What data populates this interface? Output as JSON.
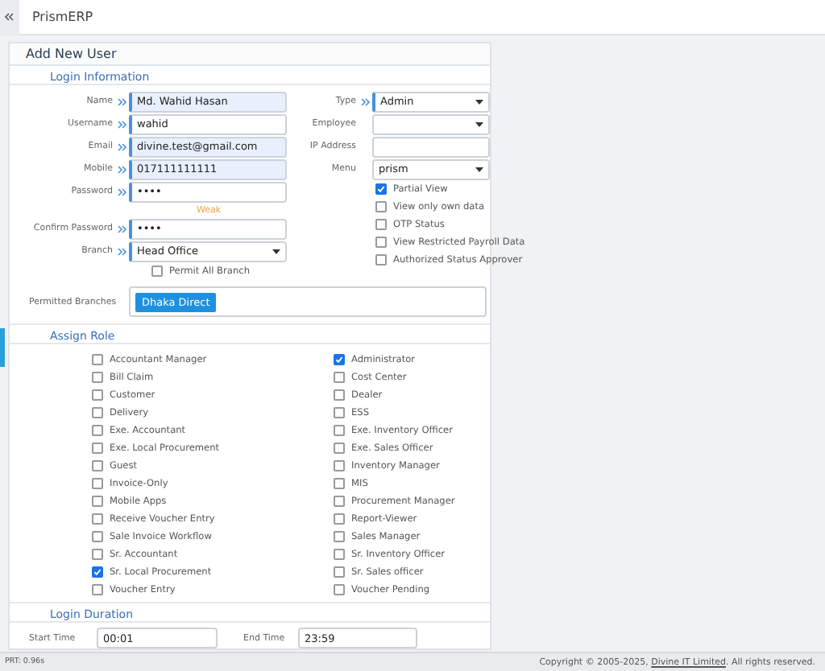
{
  "header": {
    "app_title": "PrismERP"
  },
  "form": {
    "title": "Add New User",
    "login_information": {
      "heading": "Login Information",
      "left_fields": [
        {
          "label": "Name",
          "kind": "text",
          "required": true,
          "autofilled": true,
          "value": "Md. Wahid Hasan"
        },
        {
          "label": "Username",
          "kind": "text",
          "required": true,
          "autofilled": false,
          "value": "wahid"
        },
        {
          "label": "Email",
          "kind": "text",
          "required": true,
          "autofilled": true,
          "value": "divine.test@gmail.com"
        },
        {
          "label": "Mobile",
          "kind": "text",
          "required": true,
          "autofilled": true,
          "value": "017111111111"
        },
        {
          "label": "Password",
          "kind": "password",
          "required": true,
          "autofilled": false,
          "value": "••••",
          "strength": "Weak"
        },
        {
          "label": "Confirm Password",
          "kind": "password",
          "required": true,
          "autofilled": false,
          "value": "••••"
        },
        {
          "label": "Branch",
          "kind": "select",
          "required": true,
          "autofilled": false,
          "value": "Head Office"
        }
      ],
      "permit_all_branch": {
        "label": "Permit All Branch",
        "checked": false
      },
      "right_fields": [
        {
          "label": "Type",
          "kind": "select",
          "required": true,
          "value": "Admin"
        },
        {
          "label": "Employee",
          "kind": "select",
          "required": false
        },
        {
          "label": "IP Address",
          "kind": "text",
          "required": false
        },
        {
          "label": "Menu",
          "kind": "select",
          "required": false,
          "value": "prism"
        }
      ],
      "options": [
        {
          "label": "Partial View",
          "checked": true
        },
        {
          "label": "View only own data",
          "checked": false
        },
        {
          "label": "OTP Status",
          "checked": false
        },
        {
          "label": "View Restricted Payroll Data",
          "checked": false
        },
        {
          "label": "Authorized Status Approver",
          "checked": false
        }
      ],
      "permitted_branches": {
        "label": "Permitted Branches",
        "tags": [
          "Dhaka Direct"
        ]
      }
    },
    "assign_role": {
      "heading": "Assign Role",
      "roles": [
        {
          "label": "Accountant Manager",
          "checked": false
        },
        {
          "label": "Administrator",
          "checked": true
        },
        {
          "label": "Bill Claim",
          "checked": false
        },
        {
          "label": "Cost Center",
          "checked": false
        },
        {
          "label": "Customer",
          "checked": false
        },
        {
          "label": "Dealer",
          "checked": false
        },
        {
          "label": "Delivery",
          "checked": false
        },
        {
          "label": "ESS",
          "checked": false
        },
        {
          "label": "Exe. Accountant",
          "checked": false
        },
        {
          "label": "Exe. Inventory Officer",
          "checked": false
        },
        {
          "label": "Exe. Local Procurement",
          "checked": false
        },
        {
          "label": "Exe. Sales Officer",
          "checked": false
        },
        {
          "label": "Guest",
          "checked": false
        },
        {
          "label": "Inventory Manager",
          "checked": false
        },
        {
          "label": "Invoice-Only",
          "checked": false
        },
        {
          "label": "MIS",
          "checked": false
        },
        {
          "label": "Mobile Apps",
          "checked": false
        },
        {
          "label": "Procurement Manager",
          "checked": false
        },
        {
          "label": "Receive Voucher Entry",
          "checked": false
        },
        {
          "label": "Report-Viewer",
          "checked": false
        },
        {
          "label": "Sale Invoice Workflow",
          "checked": false
        },
        {
          "label": "Sales Manager",
          "checked": false
        },
        {
          "label": "Sr. Accountant",
          "checked": false
        },
        {
          "label": "Sr. Inventory Officer",
          "checked": false
        },
        {
          "label": "Sr. Local Procurement",
          "checked": true
        },
        {
          "label": "Sr. Sales officer",
          "checked": false
        },
        {
          "label": "Voucher Entry",
          "checked": false
        },
        {
          "label": "Voucher Pending",
          "checked": false
        }
      ]
    },
    "login_duration": {
      "heading": "Login Duration",
      "start_label": "Start Time",
      "start_value": "00:01",
      "end_label": "End Time",
      "end_value": "23:59"
    }
  },
  "status_bar": {
    "timing": "PRT: 0.96s",
    "copyright_prefix": "Copyright © 2005-2025, ",
    "company_link": "Divine IT Limited",
    "copyright_suffix": ". All rights reserved."
  }
}
